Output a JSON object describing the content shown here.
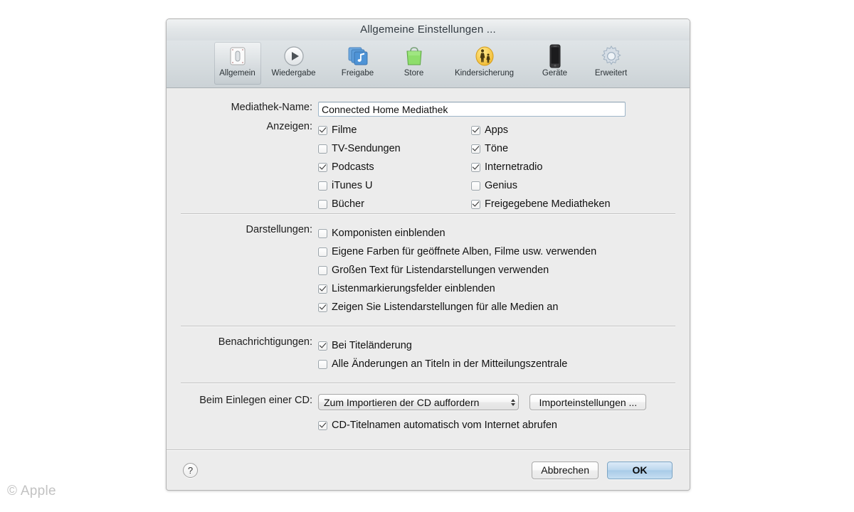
{
  "window": {
    "title": "Allgemeine Einstellungen ..."
  },
  "toolbar": {
    "items": [
      {
        "label": "Allgemein",
        "icon": "general-icon",
        "selected": true
      },
      {
        "label": "Wiedergabe",
        "icon": "playback-play-icon",
        "selected": false
      },
      {
        "label": "Freigabe",
        "icon": "sharing-icon",
        "selected": false
      },
      {
        "label": "Store",
        "icon": "store-bag-icon",
        "selected": false
      },
      {
        "label": "Kindersicherung",
        "icon": "parental-control-icon",
        "selected": false
      },
      {
        "label": "Geräte",
        "icon": "devices-iphone-icon",
        "selected": false
      },
      {
        "label": "Erweitert",
        "icon": "advanced-gear-icon",
        "selected": false
      }
    ]
  },
  "library": {
    "label": "Mediathek-Name:",
    "value": "Connected Home Mediathek",
    "placeholder": "Mediathek-Name"
  },
  "show": {
    "label": "Anzeigen:",
    "left": [
      {
        "label": "Filme",
        "checked": true
      },
      {
        "label": "TV-Sendungen",
        "checked": false
      },
      {
        "label": "Podcasts",
        "checked": true
      },
      {
        "label": "iTunes U",
        "checked": false
      },
      {
        "label": "Bücher",
        "checked": false
      }
    ],
    "right": [
      {
        "label": "Apps",
        "checked": true
      },
      {
        "label": "Töne",
        "checked": true
      },
      {
        "label": "Internetradio",
        "checked": true
      },
      {
        "label": "Genius",
        "checked": false
      },
      {
        "label": "Freigegebene Mediatheken",
        "checked": true
      }
    ]
  },
  "views": {
    "label": "Darstellungen:",
    "items": [
      {
        "label": "Komponisten einblenden",
        "checked": false
      },
      {
        "label": "Eigene Farben für geöffnete Alben, Filme usw. verwenden",
        "checked": false
      },
      {
        "label": "Großen Text für Listendarstellungen verwenden",
        "checked": false
      },
      {
        "label": "Listenmarkierungsfelder einblenden",
        "checked": true
      },
      {
        "label": "Zeigen Sie Listendarstellungen für alle Medien an",
        "checked": true
      }
    ]
  },
  "notifications": {
    "label": "Benachrichtigungen:",
    "items": [
      {
        "label": "Bei Titeländerung",
        "checked": true
      },
      {
        "label": "Alle Änderungen an Titeln in der Mitteilungszentrale",
        "checked": false
      }
    ]
  },
  "cd": {
    "label": "Beim Einlegen einer CD:",
    "popup_value": "Zum Importieren der CD auffordern",
    "import_settings_label": "Importeinstellungen ...",
    "checkbox": {
      "label": "CD-Titelnamen automatisch vom Internet abrufen",
      "checked": true
    }
  },
  "footer": {
    "help_label": "?",
    "cancel_label": "Abbrechen",
    "ok_label": "OK"
  },
  "watermark": "© Apple",
  "colors": {
    "window_bg": "#ececec",
    "toolbar_bg": "#d4dadd",
    "accent_ok": "#a9cbe8",
    "field_border": "#9eb6c9",
    "separator": "#c3c3c3"
  }
}
